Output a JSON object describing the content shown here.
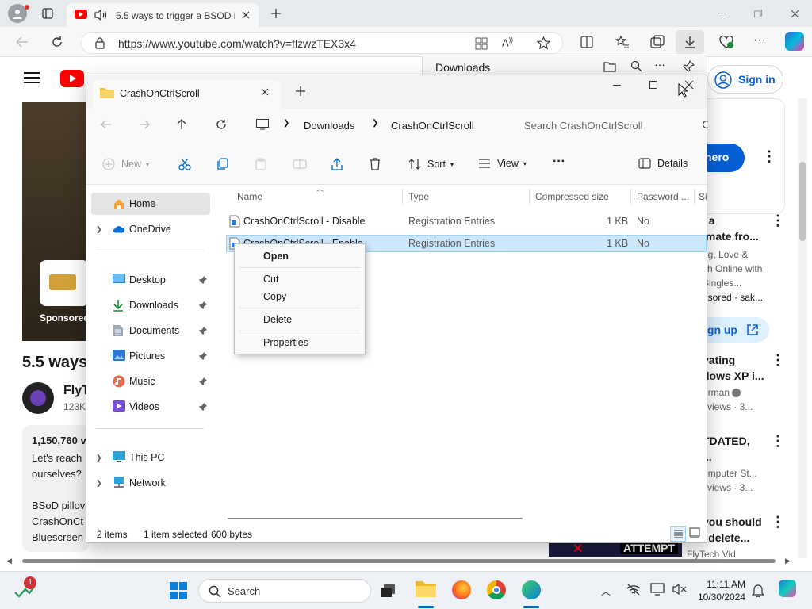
{
  "browser": {
    "tab_title": "5.5 ways to trigger a BSOD i",
    "url": "https://www.youtube.com/watch?v=flzwzTEX3x4",
    "downloads_title": "Downloads"
  },
  "youtube": {
    "sign_in": "Sign in",
    "sponsored": "Sponsored",
    "video_title": "5.5 ways",
    "channel": "FlyT",
    "subs": "123K",
    "views": "1,150,760 v",
    "desc_lines": [
      "Let's reach",
      "ourselves?",
      "",
      "BSoD pillov",
      "CrashOnCt",
      "Bluescreen"
    ],
    "hero_btn": "hero",
    "sidebar": [
      {
        "l1": "l a",
        "l2": "lmate fro...",
        "l3": "ng, Love &",
        "l4": "ch Online with",
        "l5": "Singles...",
        "l6": "nsored · sak..."
      },
      {
        "l1": "ign up"
      },
      {
        "l1": "vating",
        "l2": "dows XP i...",
        "l3": "erman",
        "l4": "l views · 3..."
      },
      {
        "l1": "TDATED,",
        "l2": "...",
        "l3": "omputer St...",
        "l4": "l views · 3..."
      },
      {
        "l1": "you should",
        "l2": "' delete...",
        "l3": "FlyTech Vid"
      }
    ],
    "attempt": "ATTEMPT"
  },
  "explorer": {
    "tab_title": "CrashOnCtrlScroll",
    "breadcrumb": [
      "Downloads",
      "CrashOnCtrlScroll"
    ],
    "search_placeholder": "Search CrashOnCtrlScroll",
    "commands": {
      "new": "New",
      "sort": "Sort",
      "view": "View",
      "more": "···",
      "details": "Details"
    },
    "nav": [
      {
        "label": "Home",
        "icon": "home-icon"
      },
      {
        "label": "OneDrive",
        "icon": "onedrive-icon"
      },
      {
        "label": "Desktop",
        "icon": "desktop-icon"
      },
      {
        "label": "Downloads",
        "icon": "downloads-icon"
      },
      {
        "label": "Documents",
        "icon": "documents-icon"
      },
      {
        "label": "Pictures",
        "icon": "pictures-icon"
      },
      {
        "label": "Music",
        "icon": "music-icon"
      },
      {
        "label": "Videos",
        "icon": "videos-icon"
      },
      {
        "label": "This PC",
        "icon": "pc-icon"
      },
      {
        "label": "Network",
        "icon": "network-icon"
      }
    ],
    "columns": [
      "Name",
      "Type",
      "Compressed size",
      "Password ...",
      "Si"
    ],
    "files": [
      {
        "name": "CrashOnCtrlScroll - Disable",
        "type": "Registration Entries",
        "size": "1 KB",
        "password": "No"
      },
      {
        "name": "CrashOnCtrlScroll - Enable",
        "type": "Registration Entries",
        "size": "1 KB",
        "password": "No"
      }
    ],
    "status": {
      "items": "2 items",
      "selected": "1 item selected",
      "bytes": "600 bytes"
    }
  },
  "context_menu": [
    "Open",
    "Cut",
    "Copy",
    "Delete",
    "Properties"
  ],
  "taskbar": {
    "search": "Search",
    "time": "11:11 AM",
    "date": "10/30/2024",
    "badge": "1"
  },
  "colors": {
    "accent": "#0067c0",
    "selection": "#cce8ff",
    "youtube_red": "#ff0000"
  }
}
